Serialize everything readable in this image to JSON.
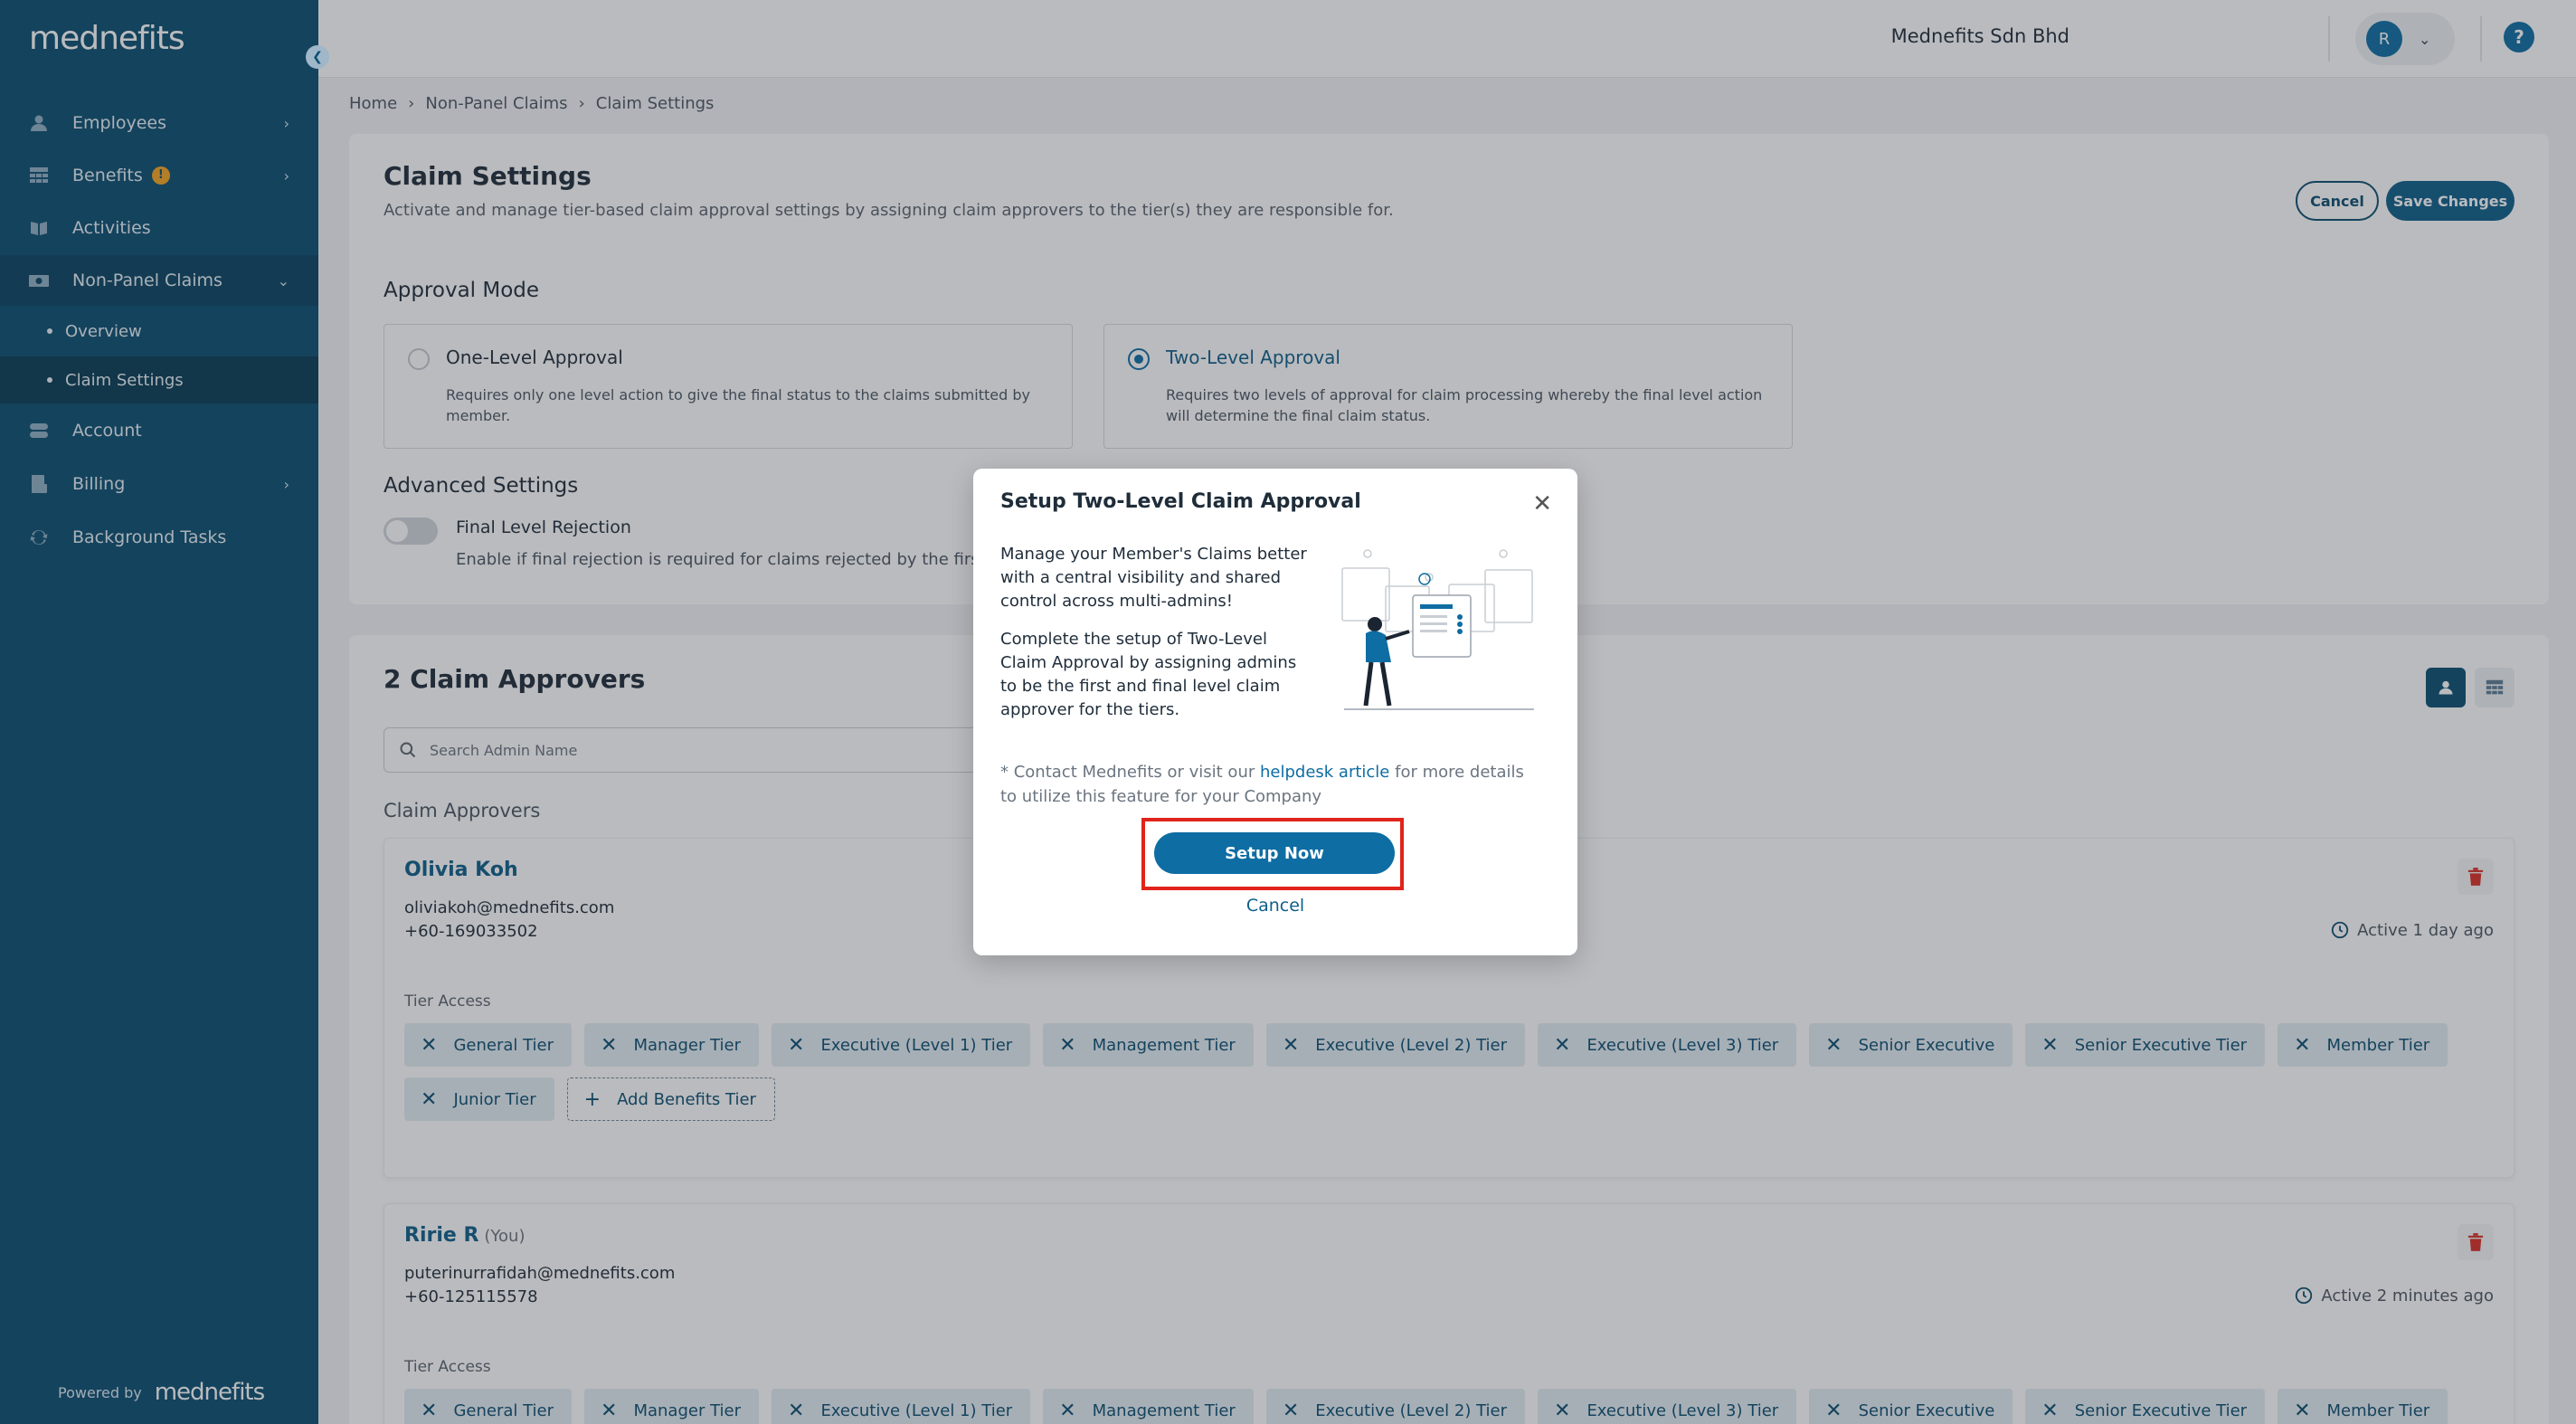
{
  "brand": {
    "logo_text": "mednefits",
    "powered_label": "Powered by",
    "powered_logo": "mednefits"
  },
  "sidebar": {
    "items": [
      {
        "label": "Employees",
        "icon": "person-icon"
      },
      {
        "label": "Benefits",
        "icon": "table-icon",
        "badge": "!"
      },
      {
        "label": "Activities",
        "icon": "book-icon"
      },
      {
        "label": "Non-Panel Claims",
        "icon": "cash-icon"
      },
      {
        "label": "Account",
        "icon": "toggle-icon"
      },
      {
        "label": "Billing",
        "icon": "receipt-icon"
      },
      {
        "label": "Background Tasks",
        "icon": "refresh-icon"
      }
    ],
    "subitems": [
      {
        "label": "Overview"
      },
      {
        "label": "Claim Settings"
      }
    ]
  },
  "topbar": {
    "company": "Mednefits Sdn Bhd",
    "avatar_initial": "R",
    "help": "?"
  },
  "breadcrumb": [
    "Home",
    "Non-Panel Claims",
    "Claim Settings"
  ],
  "settings": {
    "title": "Claim Settings",
    "description": "Activate and manage tier-based claim approval settings by assigning claim approvers to the tier(s) they are responsible for.",
    "cancel_label": "Cancel",
    "save_label": "Save Changes",
    "approval_mode_label": "Approval Mode",
    "options": [
      {
        "title": "One-Level Approval",
        "desc": "Requires only one level action to give the final status to the claims submitted by member.",
        "selected": false
      },
      {
        "title": "Two-Level Approval",
        "desc": "Requires two levels of approval for claim processing whereby the final level action will determine the final claim status.",
        "selected": true
      }
    ],
    "advanced_label": "Advanced Settings",
    "final_rejection_title": "Final Level Rejection",
    "final_rejection_desc": "Enable if final rejection is required for claims rejected by the first-le",
    "final_rejection_on": false
  },
  "approvers": {
    "title": "2 Claim Approvers",
    "search_placeholder": "Search Admin Name",
    "section_label": "Claim Approvers",
    "tier_access_label": "Tier Access",
    "add_tier_label": "Add Benefits Tier",
    "list": [
      {
        "name": "Olivia Koh",
        "you": "",
        "email": "oliviakoh@mednefits.com",
        "phone": "+60-169033502",
        "active": "Active 1 day ago",
        "tiers": [
          "General Tier",
          "Manager Tier",
          "Executive (Level 1) Tier",
          "Management Tier",
          "Executive (Level 2) Tier",
          "Executive (Level 3) Tier",
          "Senior Executive",
          "Senior Executive Tier",
          "Member Tier",
          "Junior Tier"
        ]
      },
      {
        "name": "Ririe R",
        "you": "(You)",
        "email": "puterinurrafidah@mednefits.com",
        "phone": "+60-125115578",
        "active": "Active 2 minutes ago",
        "tiers": [
          "General Tier",
          "Manager Tier",
          "Executive (Level 1) Tier",
          "Management Tier",
          "Executive (Level 2) Tier",
          "Executive (Level 3) Tier",
          "Senior Executive",
          "Senior Executive Tier",
          "Member Tier"
        ]
      }
    ]
  },
  "modal": {
    "title": "Setup Two-Level Claim Approval",
    "p1": "Manage your Member's Claims better with a central visibility and shared control across multi-admins!",
    "p2": "Complete the setup of Two-Level Claim Approval by assigning admins to be the first and final level claim approver for the tiers.",
    "note_prefix": "* Contact Mednefits or visit our ",
    "note_link": "helpdesk article",
    "note_suffix": " for more details to utilize this feature for your Company",
    "setup_label": "Setup Now",
    "cancel_label": "Cancel"
  },
  "colors": {
    "sidebar": "#0b4f71",
    "accent": "#0e6da3",
    "highlight": "#e0241b",
    "delete": "#d93025"
  }
}
